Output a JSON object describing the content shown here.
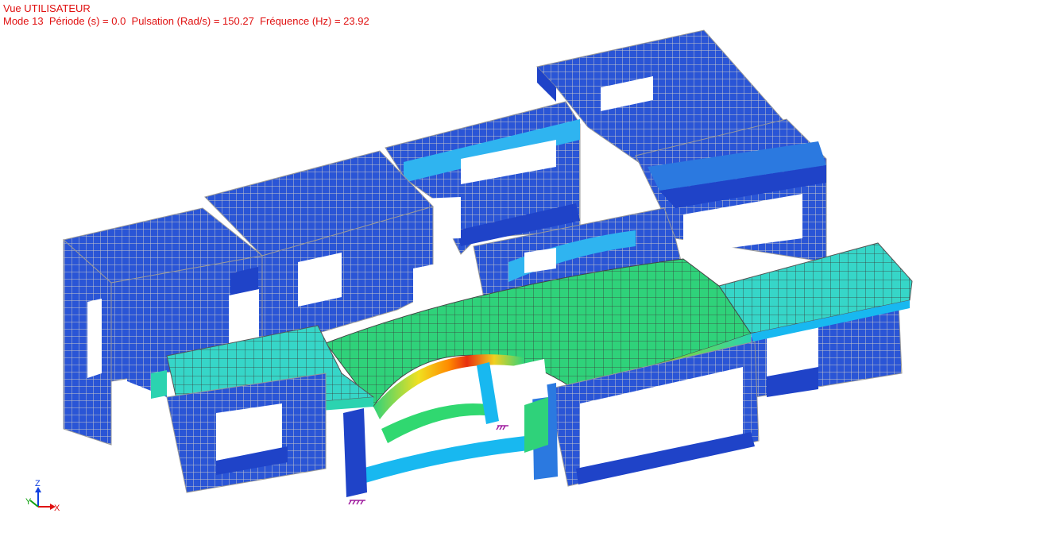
{
  "view": {
    "title": "Vue UTILISATEUR",
    "mode_label": "Mode 13",
    "period": "Période (s) = 0.0",
    "pulsation": "Pulsation (Rad/s) = 150.27",
    "frequency": "Fréquence (Hz) = 23.92"
  },
  "axes": {
    "x": "X",
    "y": "Y",
    "z": "Z"
  },
  "colors": {
    "background": "#ffffff",
    "header_text": "#e01010",
    "mesh_low": "#1e4fd8",
    "mesh_mid_low": "#18b8f0",
    "mesh_mid": "#29d36a",
    "mesh_high": "#ff8a00",
    "mesh_peak": "#e01010",
    "mesh_grid": "#b8b8b8",
    "support": "#a020a0",
    "axis_x": "#e01010",
    "axis_y": "#10a010",
    "axis_z": "#1040e0"
  },
  "icons": {
    "supports": "support-icon",
    "triad": "axis-triad-icon"
  }
}
